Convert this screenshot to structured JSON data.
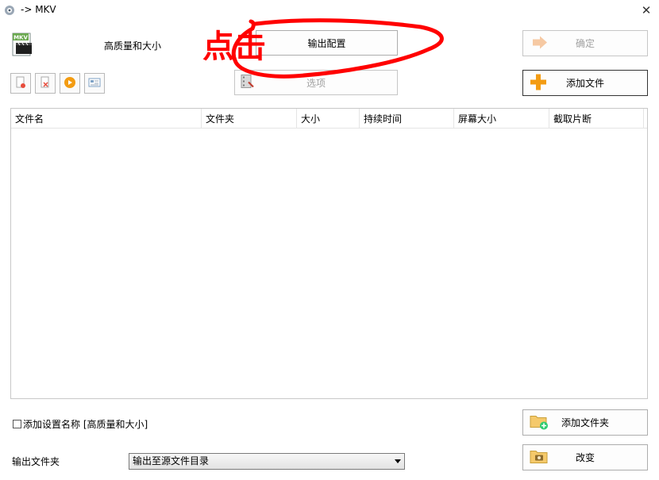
{
  "window": {
    "title": "-> MKV",
    "close_glyph": "✕"
  },
  "profile": {
    "name": "高质量和大小",
    "format_icon_text": "MKV"
  },
  "toolbar": {
    "output_config_label": "输出配置",
    "options_label": "选项",
    "ok_label": "确定",
    "add_file_label": "添加文件",
    "add_folder_label": "添加文件夹",
    "change_label": "改变"
  },
  "file_list": {
    "columns": [
      "文件名",
      "文件夹",
      "大小",
      "持续时间",
      "屏幕大小",
      "截取片断"
    ]
  },
  "options": {
    "add_setting_name_label": "添加设置名称 [高质量和大小]",
    "output_folder_label": "输出文件夹",
    "output_folder_value": "输出至源文件目录"
  },
  "annotation": {
    "text": "点击",
    "color": "#ff0000"
  }
}
